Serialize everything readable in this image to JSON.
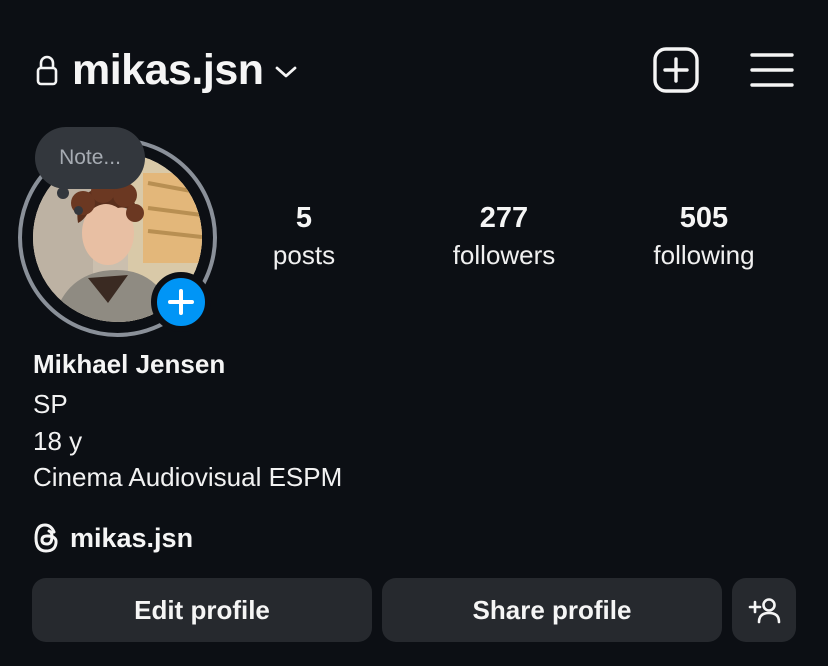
{
  "header": {
    "username": "mikas.jsn",
    "icons": {
      "lock": "lock-icon",
      "chevron": "chevron-down-icon",
      "create": "plus-square-icon",
      "menu": "hamburger-menu-icon"
    }
  },
  "profile": {
    "note_placeholder": "Note...",
    "avatar": "profile-photo",
    "add_story_icon": "plus-icon",
    "story_ring_color": "#8a9099",
    "add_story_color": "#0095f6"
  },
  "stats": [
    {
      "value": "5",
      "label": "posts"
    },
    {
      "value": "277",
      "label": "followers"
    },
    {
      "value": "505",
      "label": "following"
    }
  ],
  "bio": {
    "name": "Mikhael Jensen",
    "lines": [
      "SP",
      "18 y",
      "Cinema Audiovisual ESPM"
    ],
    "threads_handle": "mikas.jsn",
    "threads_icon": "threads-icon"
  },
  "actions": {
    "edit_label": "Edit profile",
    "share_label": "Share profile",
    "discover_icon": "add-person-icon"
  },
  "colors": {
    "background": "#0c0f14",
    "button_bg": "#26292e",
    "text": "#f5f5f5"
  }
}
